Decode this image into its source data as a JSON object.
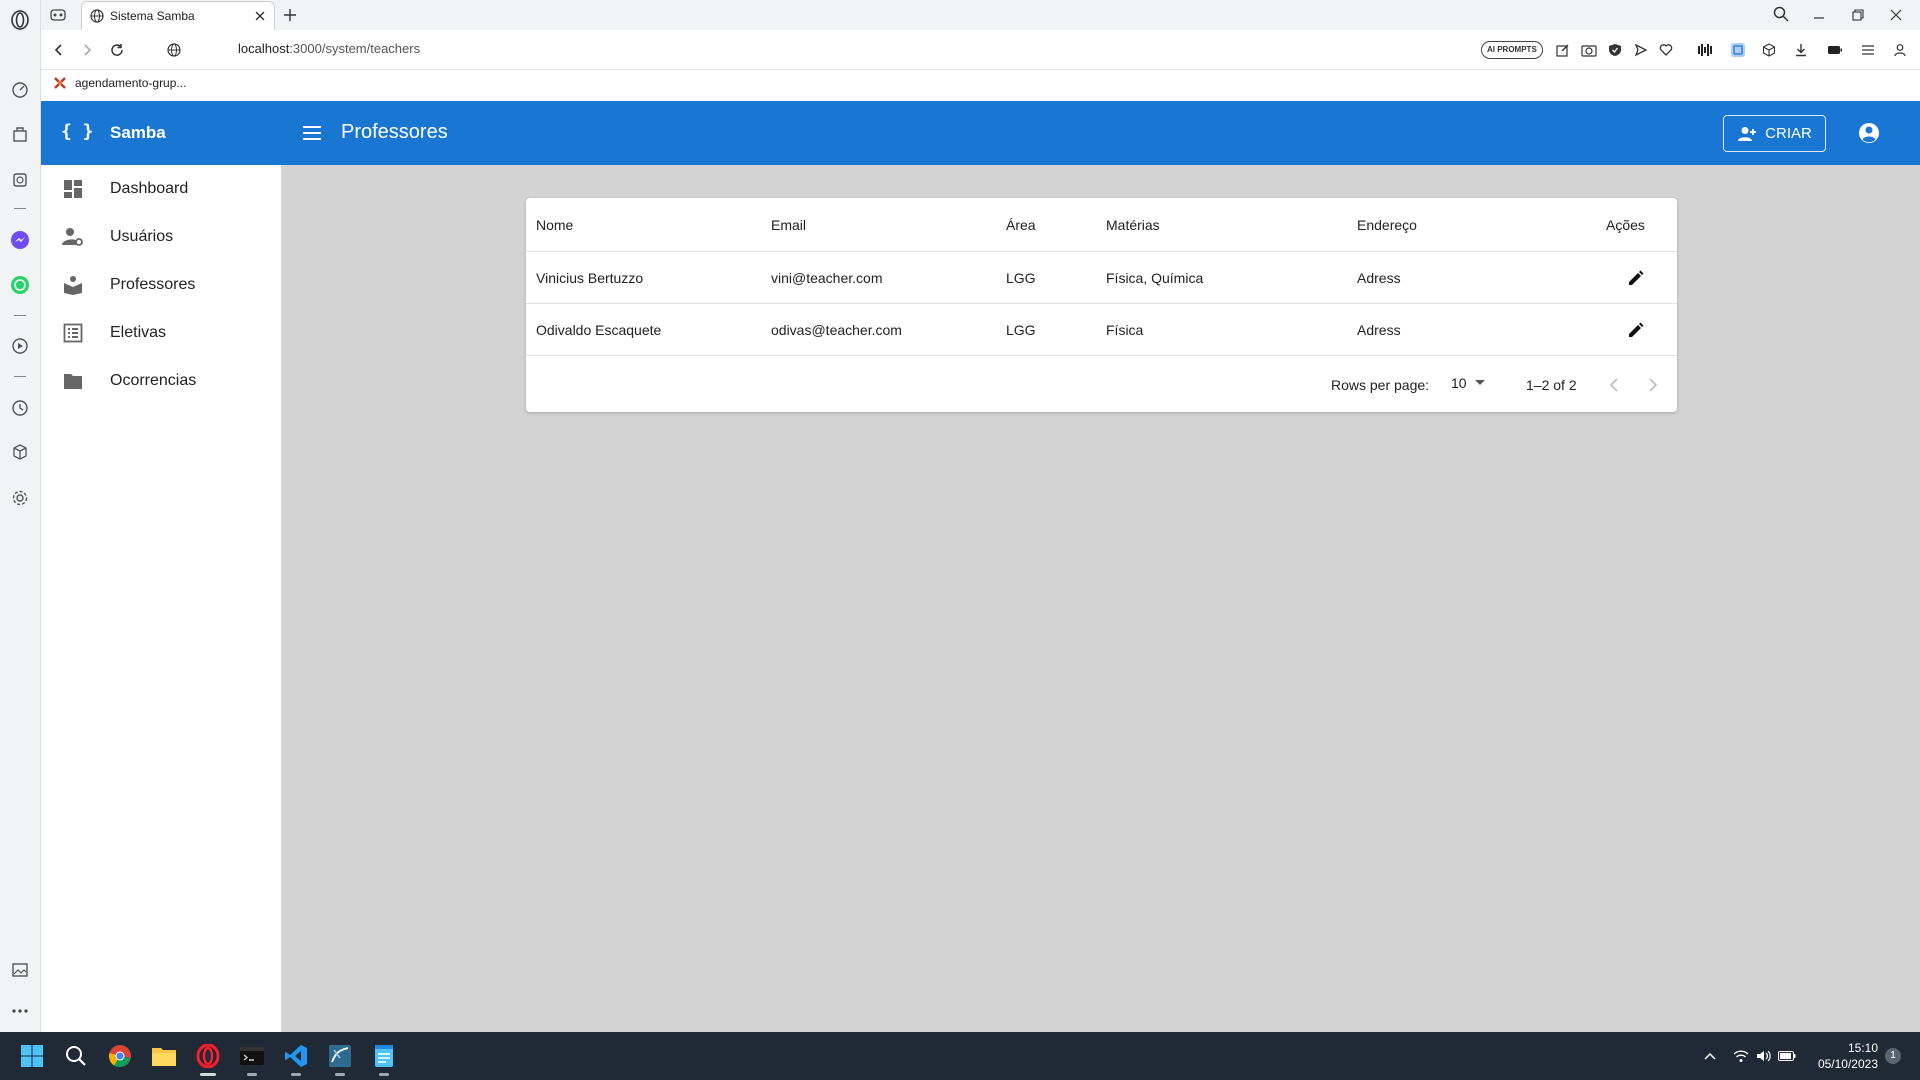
{
  "browser": {
    "tab_title": "Sistema Samba",
    "url_host": "localhost",
    "url_rest": ":3000/system/teachers",
    "ai_prompts_label": "AI PROMPTS",
    "bookmark_label": "agendamento-grup..."
  },
  "app": {
    "brand_icon": "{ }",
    "brand_name": "Samba",
    "page_title": "Professores",
    "create_label": "CRIAR",
    "primary_color": "#1976d2"
  },
  "sidebar": {
    "items": [
      {
        "label": "Dashboard",
        "icon": "dashboard-icon"
      },
      {
        "label": "Usuários",
        "icon": "manage-accounts-icon"
      },
      {
        "label": "Professores",
        "icon": "school-icon"
      },
      {
        "label": "Eletivas",
        "icon": "list-alt-icon"
      },
      {
        "label": "Ocorrencias",
        "icon": "folder-icon"
      }
    ]
  },
  "table": {
    "columns": [
      "Nome",
      "Email",
      "Área",
      "Matérias",
      "Endereço",
      "Ações"
    ],
    "rows": [
      {
        "nome": "Vinicius Bertuzzo",
        "email": "vini@teacher.com",
        "area": "LGG",
        "materias": "Física, Química",
        "endereco": "Adress"
      },
      {
        "nome": "Odivaldo Escaquete",
        "email": "odivas@teacher.com",
        "area": "LGG",
        "materias": "Física",
        "endereco": "Adress"
      }
    ],
    "rows_per_page_label": "Rows per page:",
    "rows_per_page_value": "10",
    "range_label": "1–2 of 2"
  },
  "taskbar": {
    "time": "15:10",
    "date": "05/10/2023",
    "notification_count": "1"
  }
}
